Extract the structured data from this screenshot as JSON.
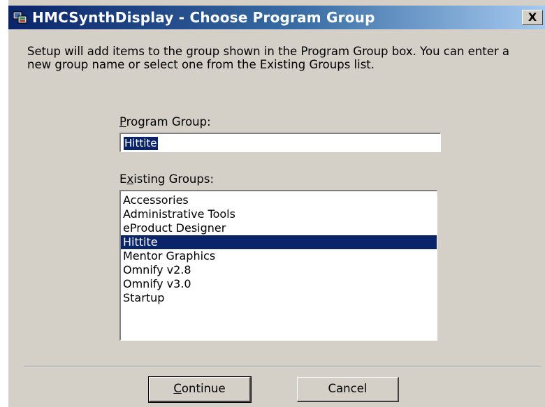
{
  "window": {
    "title": "HMCSynthDisplay - Choose Program Group",
    "close_glyph": "X",
    "icon": "setup-installer-icon"
  },
  "instructions": "Setup will add items to the group shown in the Program Group box. You can enter a new group name or select one from the Existing Groups list.",
  "program_group": {
    "label_accel": "P",
    "label_rest": "rogram Group:",
    "value": "Hittite"
  },
  "existing_groups": {
    "label_pre": "E",
    "label_accel": "x",
    "label_rest": "isting Groups:",
    "items": [
      "Accessories",
      "Administrative Tools",
      "eProduct Designer",
      "Hittite",
      "Mentor Graphics",
      "Omnify v2.8",
      "Omnify v3.0",
      "Startup"
    ],
    "selected": "Hittite"
  },
  "buttons": {
    "continue_accel": "C",
    "continue_rest": "ontinue",
    "cancel": "Cancel"
  },
  "colors": {
    "title_active": "#0a246a",
    "dialog_face": "#d4d0c8",
    "selection": "#0a246a"
  }
}
